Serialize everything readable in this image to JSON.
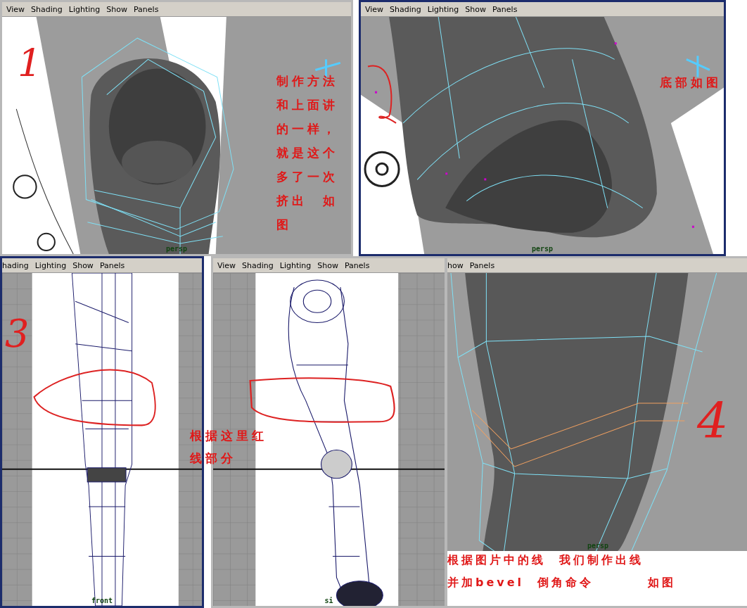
{
  "viewports": [
    {
      "kind": "top_opening",
      "selected": false,
      "menu": [
        "View",
        "Shading",
        "Lighting",
        "Show",
        "Panels"
      ],
      "camera_label": "persp",
      "number": "1",
      "notes": [
        "制作方法",
        "和上面讲",
        "的一样，",
        "就是这个",
        "多了一次",
        "挤出  如",
        "图"
      ]
    },
    {
      "kind": "bottom_opening",
      "selected": true,
      "menu": [
        "View",
        "Shading",
        "Lighting",
        "Show",
        "Panels"
      ],
      "camera_label": "persp",
      "notes": [
        "底部如图"
      ]
    },
    {
      "kind": "front",
      "selected": true,
      "menu": [
        "hading",
        "Lighting",
        "Show",
        "Panels"
      ],
      "camera_label": "front",
      "number": "3"
    },
    {
      "kind": "side",
      "selected": false,
      "menu": [
        "View",
        "Shading",
        "Lighting",
        "Show",
        "Panels"
      ],
      "camera_label": "si"
    },
    {
      "kind": "knee",
      "selected": false,
      "menu": [
        "how",
        "Panels"
      ],
      "camera_label": "persp",
      "number": "4",
      "footer_notes": [
        "根据图片中的线  我们制作出线",
        "并加bevel  倒角命令        如图"
      ]
    }
  ],
  "overlay_note": [
    "根据这里红",
    "线部分"
  ]
}
